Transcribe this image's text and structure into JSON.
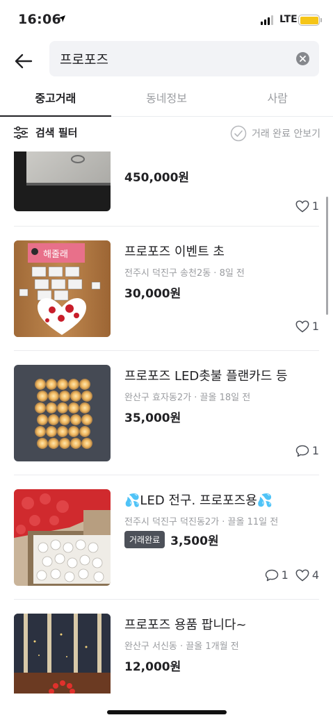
{
  "status": {
    "time": "16:06",
    "network": "LTE"
  },
  "search": {
    "query": "프로포즈"
  },
  "tabs": [
    {
      "label": "중고거래",
      "active": true
    },
    {
      "label": "동네정보",
      "active": false
    },
    {
      "label": "사람",
      "active": false
    }
  ],
  "filter": {
    "label": "검색 필터",
    "hide_done_label": "거래 완료 안보기"
  },
  "items": [
    {
      "title": "",
      "meta": "",
      "price": "450,000원",
      "likes": "1",
      "comments": "",
      "badge": ""
    },
    {
      "title": "프로포즈 이벤트 초",
      "meta": "전주시 덕진구 송천2동 · 8일 전",
      "price": "30,000원",
      "likes": "1",
      "comments": "",
      "badge": ""
    },
    {
      "title": "프로포즈 LED촛불 플랜카드 등",
      "meta": "완산구 효자동2가 · 끌올 18일 전",
      "price": "35,000원",
      "likes": "",
      "comments": "1",
      "badge": ""
    },
    {
      "title": "💦LED 전구. 프로포즈용💦",
      "meta": "전주시 덕진구 덕진동2가 · 끌올 11일 전",
      "price": "3,500원",
      "likes": "4",
      "comments": "1",
      "badge": "거래완료"
    },
    {
      "title": "프로포즈 용품 팝니다~",
      "meta": "완산구 서신동 · 끌올 1개월 전",
      "price": "12,000원",
      "likes": "",
      "comments": "",
      "badge": ""
    }
  ],
  "banner_text": "해줄래",
  "colors": {
    "accent": "#212124",
    "muted": "#9a9ca0",
    "badge_bg": "#4d5159",
    "battery": "#f5c518",
    "search_bg": "#f2f3f6"
  }
}
